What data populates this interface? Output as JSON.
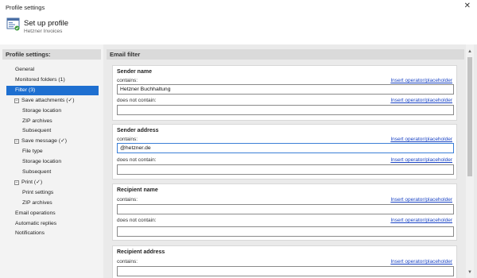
{
  "window": {
    "title": "Profile settings",
    "close": "✕"
  },
  "header": {
    "title": "Set up profile",
    "subtitle": "Hetzner Invoices"
  },
  "sidebar": {
    "heading": "Profile settings:",
    "items": [
      {
        "label": "General",
        "indent": 0
      },
      {
        "label": "Monitored folders (1)",
        "indent": 0
      },
      {
        "label": "Filter (3)",
        "indent": 0,
        "selected": true
      },
      {
        "label": "Save attachments (✓)",
        "indent": 0,
        "toggle": "−"
      },
      {
        "label": "Storage location",
        "indent": 2
      },
      {
        "label": "ZIP archives",
        "indent": 2
      },
      {
        "label": "Subsequent",
        "indent": 2
      },
      {
        "label": "Save message (✓)",
        "indent": 0,
        "toggle": "−"
      },
      {
        "label": "File type",
        "indent": 2
      },
      {
        "label": "Storage location",
        "indent": 2
      },
      {
        "label": "Subsequent",
        "indent": 2
      },
      {
        "label": "Print (✓)",
        "indent": 0,
        "toggle": "−"
      },
      {
        "label": "Print settings",
        "indent": 2
      },
      {
        "label": "ZIP archives",
        "indent": 2
      },
      {
        "label": "Email operations",
        "indent": 0
      },
      {
        "label": "Automatic replies",
        "indent": 0
      },
      {
        "label": "Notifications",
        "indent": 0
      }
    ]
  },
  "main": {
    "heading": "Email filter",
    "groups": [
      {
        "title": "Sender name",
        "contains_label": "contains:",
        "contains_value": "Hetzner Buchhaltung",
        "not_contains_label": "does not contain:",
        "not_contains_value": "",
        "link": "Insert operator/placeholder"
      },
      {
        "title": "Sender address",
        "contains_label": "contains:",
        "contains_value": "@hetzner.de",
        "not_contains_label": "does not contain:",
        "not_contains_value": "",
        "link": "Insert operator/placeholder"
      },
      {
        "title": "Recipient name",
        "contains_label": "contains:",
        "contains_value": "",
        "not_contains_label": "does not contain:",
        "not_contains_value": "",
        "link": "Insert operator/placeholder"
      },
      {
        "title": "Recipient address",
        "contains_label": "contains:",
        "contains_value": "",
        "link": "Insert operator/placeholder"
      }
    ]
  },
  "colors": {
    "selected": "#1e6fd0",
    "link": "#1a44c4",
    "focus": "#3c7fd6"
  }
}
